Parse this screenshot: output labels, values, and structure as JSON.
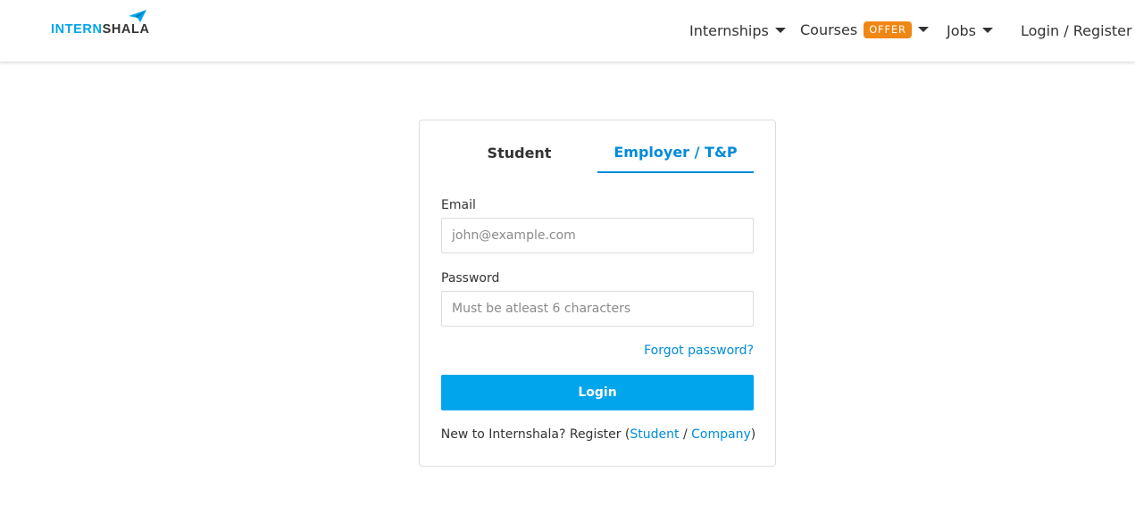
{
  "brand": {
    "name_part1": "INTERN",
    "name_part2": "SHALA",
    "logo_icon": "paper-plane-icon",
    "accent_color": "#00a5ec"
  },
  "nav": {
    "internships": "Internships",
    "courses": "Courses",
    "offer_badge": "OFFER",
    "jobs": "Jobs",
    "login_register": "Login / Register"
  },
  "tabs": {
    "student": "Student",
    "employer": "Employer / T&P",
    "active": "employer"
  },
  "form": {
    "email_label": "Email",
    "email_placeholder": "john@example.com",
    "password_label": "Password",
    "password_placeholder": "Must be atleast 6 characters",
    "forgot_password": "Forgot password?",
    "login_button": "Login"
  },
  "register": {
    "prefix": "New to Internshala? Register (",
    "student": "Student",
    "separator": " / ",
    "company": "Company",
    "suffix": ")"
  },
  "colors": {
    "link": "#008bdc",
    "button": "#00a5ec",
    "offer_badge": "#f08613"
  }
}
